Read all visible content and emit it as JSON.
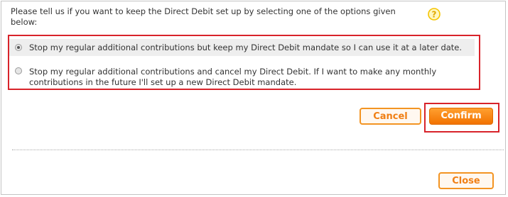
{
  "dialog": {
    "intro_text": "Please tell us if you want to keep the Direct Debit set up by selecting one of the options given below:",
    "help_icon": "question-mark-circle-icon",
    "options": [
      {
        "label": "Stop my regular additional contributions but keep my Direct Debit mandate so I can use it at a later date.",
        "selected": true
      },
      {
        "label": "Stop my regular additional contributions and cancel my Direct Debit. If I want to make any monthly contributions in the future I'll set up a new Direct Debit mandate.",
        "selected": false
      }
    ],
    "cancel_label": "Cancel",
    "confirm_label": "Confirm",
    "close_label": "Close"
  },
  "colors": {
    "accent_orange": "#f27200",
    "highlight_red": "#d8232a",
    "help_yellow": "#f5c400"
  }
}
